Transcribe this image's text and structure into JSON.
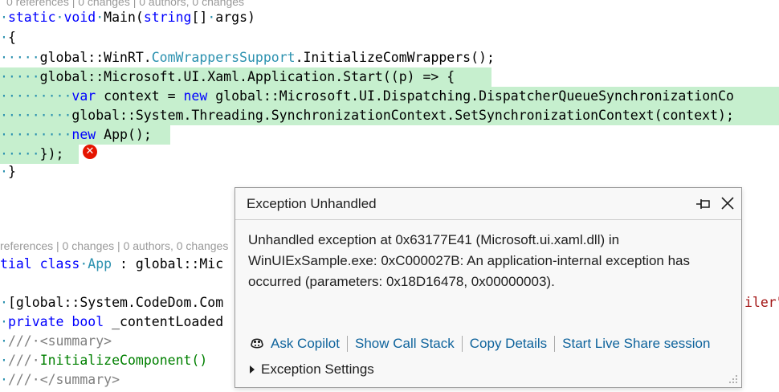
{
  "code": {
    "lens_top": "0 references | 0 changes | 0 authors, 0 changes",
    "line_main_sig": [
      "static",
      "void",
      "Main",
      "(",
      "string",
      "[]",
      "args",
      ")"
    ],
    "open_brace": "{",
    "l_init_prefix": "global::WinRT.",
    "l_init_type": "ComWrappersSupport",
    "l_init_call": ".InitializeComWrappers();",
    "l_start": "global::Microsoft.UI.Xaml.Application.Start((p) => {",
    "l_context_kw1": "var",
    "l_context_mid": " context = ",
    "l_context_kw2": "new",
    "l_context_rest": " global::Microsoft.UI.Dispatching.DispatcherQueueSynchronizationCo",
    "l_sync": "global::System.Threading.SynchronizationContext.SetSynchronizationContext(context);",
    "l_new_kw": "new",
    "l_new_rest": " App();",
    "l_close_lambda": "});",
    "close_brace": "}",
    "lens_mid": "references | 0 changes | 0 authors, 0 changes",
    "l_partial_kw": "tial class",
    "l_partial_type": "App",
    "l_partial_rest": " : global::Mic",
    "l_attr_pre": "[global::System.CodeDom.Com",
    "l_attr_tail": "iler\"",
    "l_private_kw": "private bool",
    "l_private_rest": " _contentLoaded",
    "l_summary_open": "<summary>",
    "l_init_component": "InitializeComponent()",
    "l_summary_close": "</summary>"
  },
  "popup": {
    "title": "Exception Unhandled",
    "message": "Unhandled exception at 0x63177E41 (Microsoft.ui.xaml.dll) in WinUIExSample.exe: 0xC000027B: An application-internal exception has occurred (parameters: 0x18D16478, 0x00000003).",
    "actions": [
      "Ask Copilot",
      "Show Call Stack",
      "Copy Details",
      "Start Live Share session"
    ],
    "settings_label": "Exception Settings"
  },
  "colors": {
    "highlight": "#c6efce",
    "keyword": "#0000ff",
    "type": "#2b91af",
    "link": "#0e639c",
    "error": "#e51400"
  },
  "icons": [
    "pin-icon",
    "close-icon",
    "copilot-icon",
    "error-icon",
    "expand-triangle-icon",
    "resize-grip-icon"
  ]
}
